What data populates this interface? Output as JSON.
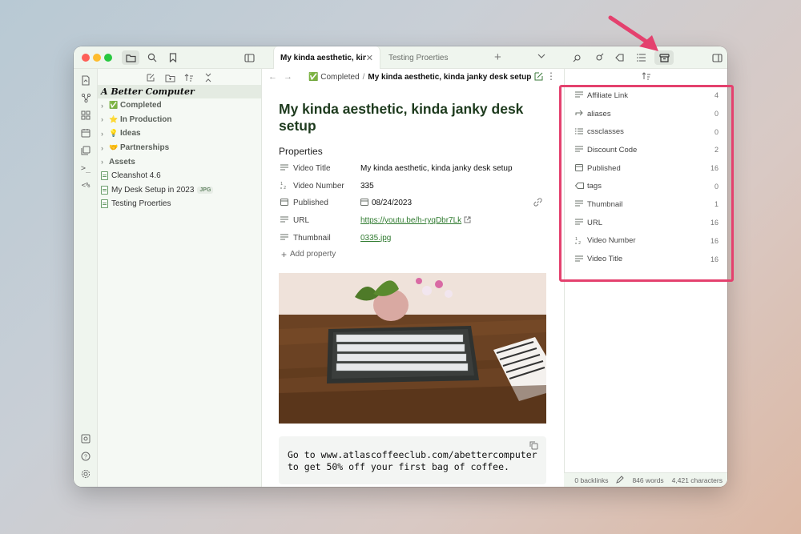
{
  "colors": {
    "accent": "#2f7a2f",
    "highlight": "#e4416e",
    "sidebar_bg": "#eff5ee"
  },
  "tabs": [
    {
      "label": "My kinda aesthetic, kinda...",
      "active": true
    },
    {
      "label": "Testing Proerties",
      "active": false
    }
  ],
  "vault": {
    "name": "A Better Computer"
  },
  "explorer": {
    "items": [
      {
        "type": "folder",
        "emoji": "✅",
        "label": "Completed"
      },
      {
        "type": "folder",
        "emoji": "⭐",
        "label": "In Production"
      },
      {
        "type": "folder",
        "emoji": "💡",
        "label": "Ideas"
      },
      {
        "type": "folder",
        "emoji": "🤝",
        "label": "Partnerships"
      },
      {
        "type": "folder",
        "emoji": "",
        "label": "Assets"
      },
      {
        "type": "file",
        "label": "Cleanshot 4.6",
        "badge": ""
      },
      {
        "type": "file",
        "label": "My Desk Setup in 2023",
        "badge": "JPG"
      },
      {
        "type": "file",
        "label": "Testing Proerties",
        "badge": ""
      }
    ]
  },
  "breadcrumb": {
    "parent": "✅ Completed",
    "separator": "/",
    "current": "My kinda aesthetic, kinda janky desk setup"
  },
  "note": {
    "title": "My kinda aesthetic, kinda janky desk setup",
    "properties_heading": "Properties",
    "properties": [
      {
        "icon": "text-icon",
        "key": "Video Title",
        "value": "My kinda aesthetic, kinda janky desk setup"
      },
      {
        "icon": "number-icon",
        "key": "Video Number",
        "value": "335"
      },
      {
        "icon": "calendar-icon",
        "key": "Published",
        "value": "08/24/2023"
      },
      {
        "icon": "text-icon",
        "key": "URL",
        "value": "https://youtu.be/h-ryqDbr7Lk"
      },
      {
        "icon": "text-icon",
        "key": "Thumbnail",
        "value": "0335.jpg"
      }
    ],
    "add_property": "Add property",
    "code_text": "Go to www.atlascoffeeclub.com/abettercomputer to get 50% off your first bag of coffee."
  },
  "all_properties": [
    {
      "icon": "text-icon",
      "name": "Affiliate Link",
      "count": "4"
    },
    {
      "icon": "alias-icon",
      "name": "aliases",
      "count": "0"
    },
    {
      "icon": "list-icon",
      "name": "cssclasses",
      "count": "0"
    },
    {
      "icon": "text-icon",
      "name": "Discount Code",
      "count": "2"
    },
    {
      "icon": "calendar-icon",
      "name": "Published",
      "count": "16"
    },
    {
      "icon": "tag-icon",
      "name": "tags",
      "count": "0"
    },
    {
      "icon": "text-icon",
      "name": "Thumbnail",
      "count": "1"
    },
    {
      "icon": "text-icon",
      "name": "URL",
      "count": "16"
    },
    {
      "icon": "number-icon",
      "name": "Video Number",
      "count": "16"
    },
    {
      "icon": "text-icon",
      "name": "Video Title",
      "count": "16"
    }
  ],
  "status": {
    "backlinks": "0 backlinks",
    "words": "846 words",
    "characters": "4,421 characters"
  }
}
